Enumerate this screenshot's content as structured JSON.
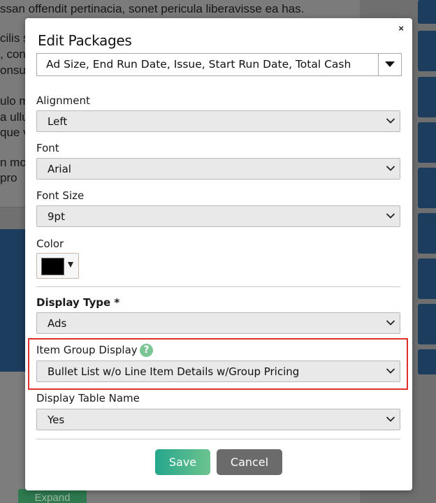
{
  "background": {
    "doc_lines": [
      "ssan offendit pertinacia, sonet pericula liberavisse ea has.",
      "cilis s",
      ", con",
      "onsu",
      "ulo m",
      "a ullu",
      "que v",
      "n mo",
      " pro"
    ],
    "expand_label": "Expand"
  },
  "modal": {
    "title": "Edit Packages",
    "close_label": "×",
    "columns_value": "Ad Size, End Run Date, Issue, Start Run Date, Total Cash",
    "alignment": {
      "label": "Alignment",
      "value": "Left"
    },
    "font": {
      "label": "Font",
      "value": "Arial"
    },
    "font_size": {
      "label": "Font Size",
      "value": "9pt"
    },
    "color": {
      "label": "Color",
      "value": "#000000"
    },
    "display_type": {
      "label": "Display Type *",
      "value": "Ads"
    },
    "item_group_display": {
      "label": "Item Group Display",
      "value": "Bullet List w/o Line Item Details w/Group Pricing",
      "help_glyph": "?"
    },
    "display_table_name": {
      "label": "Display Table Name",
      "value": "Yes"
    },
    "save_label": "Save",
    "cancel_label": "Cancel"
  },
  "icons": {
    "select_chevron": "chevron-down-icon",
    "help": "help-icon",
    "close": "close-icon"
  },
  "colors": {
    "save_button": "#3cb08c",
    "cancel_button": "#6b6b6b",
    "highlight": "#e0302a",
    "help": "#7bc494"
  }
}
